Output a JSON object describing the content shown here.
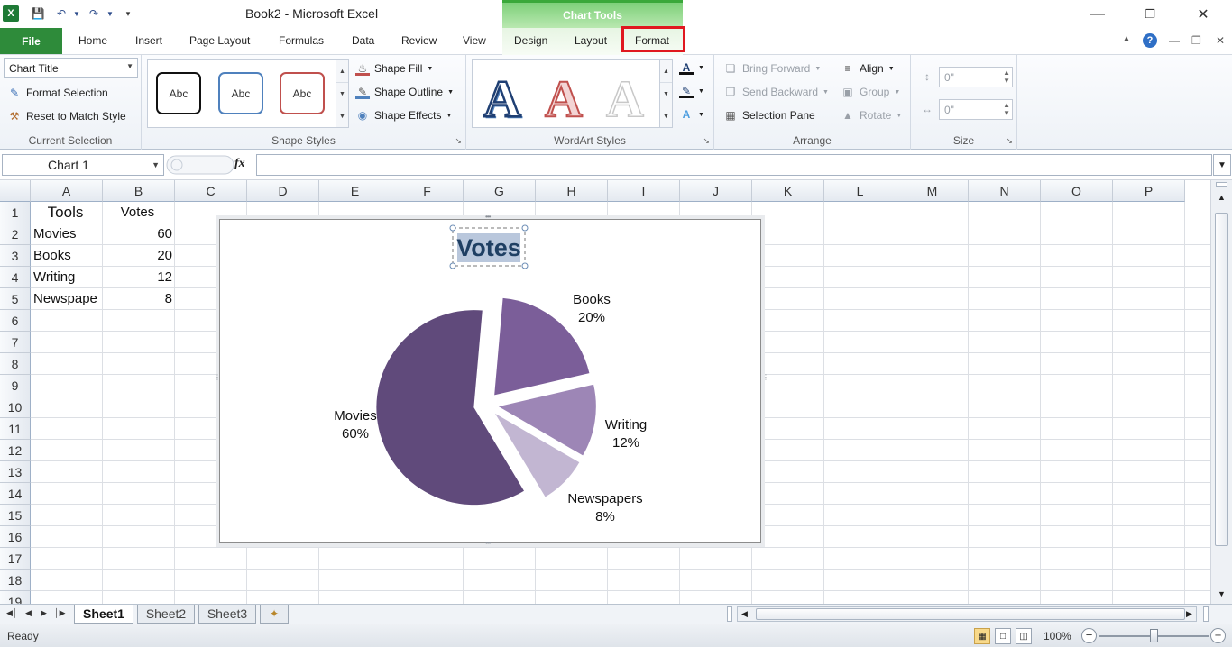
{
  "window": {
    "title": "Book2  -  Microsoft Excel",
    "context_tab_group": "Chart Tools"
  },
  "ribbon_tabs": {
    "file": "File",
    "items": [
      "Home",
      "Insert",
      "Page Layout",
      "Formulas",
      "Data",
      "Review",
      "View",
      "Design",
      "Layout",
      "Format"
    ],
    "active": "Format"
  },
  "ribbon": {
    "current_selection": {
      "selected_element": "Chart Title",
      "format_selection": "Format Selection",
      "reset_to_match_style": "Reset to Match Style",
      "label": "Current Selection"
    },
    "shape_styles": {
      "presets": [
        "Abc",
        "Abc",
        "Abc"
      ],
      "shape_fill": "Shape Fill",
      "shape_outline": "Shape Outline",
      "shape_effects": "Shape Effects",
      "label": "Shape Styles"
    },
    "wordart_styles": {
      "presets": [
        "A",
        "A",
        "A"
      ],
      "label": "WordArt Styles"
    },
    "arrange": {
      "bring_forward": "Bring Forward",
      "send_backward": "Send Backward",
      "selection_pane": "Selection Pane",
      "align": "Align",
      "group": "Group",
      "rotate": "Rotate",
      "label": "Arrange"
    },
    "size": {
      "height": "0\"",
      "width": "0\"",
      "label": "Size"
    }
  },
  "formula_bar": {
    "name_box": "Chart 1",
    "fx": "fx",
    "formula": ""
  },
  "sheet": {
    "columns": [
      "A",
      "B",
      "C",
      "D",
      "E",
      "F",
      "G",
      "H",
      "I",
      "J",
      "K",
      "L",
      "M",
      "N",
      "O",
      "P"
    ],
    "rows": [
      "1",
      "2",
      "3",
      "4",
      "5",
      "6",
      "7",
      "8",
      "9",
      "10",
      "11",
      "12",
      "13",
      "14",
      "15",
      "16",
      "17",
      "18",
      "19"
    ],
    "cells": [
      [
        "Tools",
        "Votes"
      ],
      [
        "Movies",
        "60"
      ],
      [
        "Books",
        "20"
      ],
      [
        "Writing",
        "12"
      ],
      [
        "Newspape",
        "8"
      ]
    ]
  },
  "chart_data": {
    "type": "pie",
    "title": "Votes",
    "categories": [
      "Movies",
      "Books",
      "Writing",
      "Newspapers"
    ],
    "values": [
      60,
      20,
      12,
      8
    ],
    "percent_labels": [
      "60%",
      "20%",
      "12%",
      "8%"
    ],
    "colors": [
      "#604a7b",
      "#7b5e99",
      "#9d86b6",
      "#c2b6d2"
    ],
    "exploded": true,
    "legend": "none"
  },
  "sheet_tabs": {
    "items": [
      "Sheet1",
      "Sheet2",
      "Sheet3"
    ],
    "active": "Sheet1"
  },
  "status": {
    "text": "Ready",
    "zoom": "100%",
    "zoom_value": 100
  }
}
